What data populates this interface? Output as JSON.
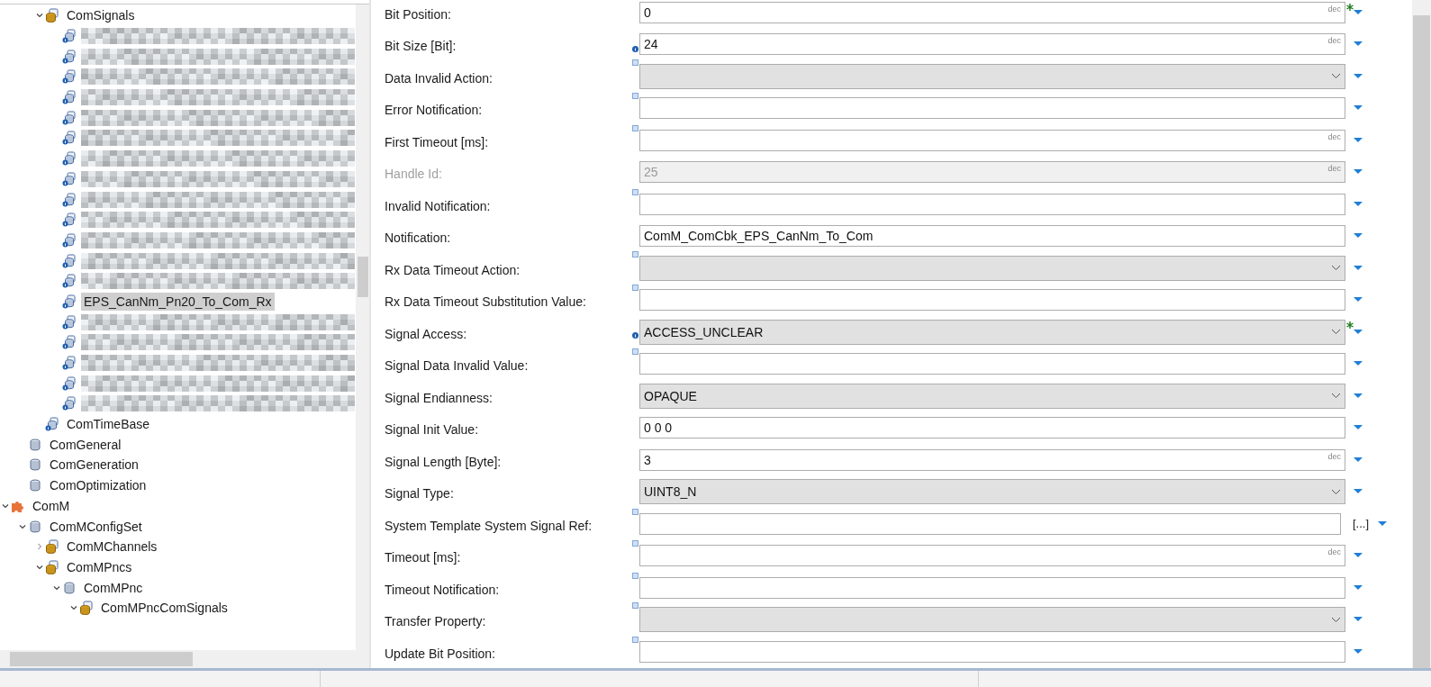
{
  "tree": {
    "items": [
      {
        "kind": "hidden",
        "children": [
          {
            "kind": "hidden",
            "children": [
              {
                "label": "ComSignals",
                "kind": "container",
                "expanded": true,
                "selected": false,
                "children": [
                  {
                    "kind": "signal",
                    "blurred": true,
                    "selected": false
                  },
                  {
                    "kind": "signal",
                    "blurred": true,
                    "selected": false
                  },
                  {
                    "kind": "signal",
                    "blurred": true,
                    "selected": false
                  },
                  {
                    "kind": "signal",
                    "blurred": true,
                    "selected": false
                  },
                  {
                    "kind": "signal",
                    "blurred": true,
                    "selected": false
                  },
                  {
                    "kind": "signal",
                    "blurred": true,
                    "selected": false
                  },
                  {
                    "kind": "signal",
                    "blurred": true,
                    "selected": false
                  },
                  {
                    "kind": "signal",
                    "blurred": true,
                    "selected": false
                  },
                  {
                    "kind": "signal",
                    "blurred": true,
                    "selected": false
                  },
                  {
                    "kind": "signal",
                    "blurred": true,
                    "selected": false
                  },
                  {
                    "kind": "signal",
                    "blurred": true,
                    "selected": false
                  },
                  {
                    "kind": "signal",
                    "blurred": true,
                    "selected": false
                  },
                  {
                    "kind": "signal",
                    "blurred": true,
                    "selected": false
                  },
                  {
                    "label": "EPS_CanNm_Pn20_To_Com_Rx",
                    "kind": "signal",
                    "blurred": false,
                    "selected": true
                  },
                  {
                    "kind": "signal",
                    "blurred": true,
                    "selected": false
                  },
                  {
                    "kind": "signal",
                    "blurred": true,
                    "selected": false
                  },
                  {
                    "kind": "signal",
                    "blurred": true,
                    "selected": false
                  },
                  {
                    "kind": "signal",
                    "blurred": true,
                    "selected": false
                  },
                  {
                    "kind": "signal",
                    "blurred": true,
                    "selected": false
                  }
                ]
              },
              {
                "label": "ComTimeBase",
                "kind": "signal",
                "selected": false
              }
            ]
          },
          {
            "label": "ComGeneral",
            "kind": "parameter",
            "selected": false
          },
          {
            "label": "ComGeneration",
            "kind": "parameter",
            "selected": false
          },
          {
            "label": "ComOptimization",
            "kind": "parameter",
            "selected": false
          }
        ]
      },
      {
        "label": "ComM",
        "kind": "module",
        "expanded": true,
        "selected": false,
        "children": [
          {
            "label": "ComMConfigSet",
            "kind": "parameter",
            "expanded": true,
            "selected": false,
            "children": [
              {
                "label": "ComMChannels",
                "kind": "container",
                "expanded": false,
                "selected": false
              },
              {
                "label": "ComMPncs",
                "kind": "container",
                "expanded": true,
                "selected": false,
                "children": [
                  {
                    "label": "ComMPnc",
                    "kind": "parameter",
                    "expanded": true,
                    "selected": false,
                    "children": [
                      {
                        "label": "ComMPncComSignals",
                        "kind": "container",
                        "expanded": true,
                        "selected": false
                      }
                    ]
                  }
                ]
              }
            ]
          }
        ]
      }
    ]
  },
  "properties": [
    {
      "label": "Bit Position:",
      "kind": "number",
      "value": "0",
      "unit": "dec",
      "info_marker": false,
      "unset_marker": false,
      "modified": true,
      "disabled": false
    },
    {
      "label": "Bit Size [Bit]:",
      "kind": "number",
      "value": "24",
      "unit": "dec",
      "info_marker": true,
      "unset_marker": false,
      "modified": false,
      "disabled": false
    },
    {
      "label": "Data Invalid Action:",
      "kind": "combo",
      "info_marker": false,
      "unset_marker": true,
      "modified": false,
      "disabled": false
    },
    {
      "label": "Error Notification:",
      "kind": "text",
      "info_marker": false,
      "unset_marker": true,
      "modified": false,
      "disabled": false
    },
    {
      "label": "First Timeout [ms]:",
      "kind": "number",
      "unit": "dec",
      "info_marker": false,
      "unset_marker": true,
      "modified": false,
      "disabled": false
    },
    {
      "label": "Handle Id:",
      "kind": "number",
      "value": "25",
      "unit": "dec",
      "info_marker": false,
      "unset_marker": false,
      "modified": false,
      "disabled": true
    },
    {
      "label": "Invalid Notification:",
      "kind": "text",
      "info_marker": false,
      "unset_marker": true,
      "modified": false,
      "disabled": false
    },
    {
      "label": "Notification:",
      "kind": "text",
      "value": "ComM_ComCbk_EPS_CanNm_To_Com",
      "info_marker": false,
      "unset_marker": false,
      "modified": false,
      "disabled": false
    },
    {
      "label": "Rx Data Timeout Action:",
      "kind": "combo",
      "info_marker": false,
      "unset_marker": true,
      "modified": false,
      "disabled": false
    },
    {
      "label": "Rx Data Timeout Substitution Value:",
      "kind": "text",
      "info_marker": false,
      "unset_marker": true,
      "modified": false,
      "disabled": false
    },
    {
      "label": "Signal Access:",
      "kind": "combo",
      "value": "ACCESS_UNCLEAR",
      "info_marker": true,
      "unset_marker": false,
      "modified": true,
      "disabled": false
    },
    {
      "label": "Signal Data Invalid Value:",
      "kind": "text",
      "info_marker": false,
      "unset_marker": true,
      "modified": false,
      "disabled": false
    },
    {
      "label": "Signal Endianness:",
      "kind": "combo",
      "value": "OPAQUE",
      "info_marker": false,
      "unset_marker": false,
      "modified": false,
      "disabled": false
    },
    {
      "label": "Signal Init Value:",
      "kind": "text",
      "value": "0 0 0",
      "info_marker": false,
      "unset_marker": false,
      "modified": false,
      "disabled": false
    },
    {
      "label": "Signal Length [Byte]:",
      "kind": "number",
      "value": "3",
      "unit": "dec",
      "info_marker": false,
      "unset_marker": false,
      "modified": false,
      "disabled": false
    },
    {
      "label": "Signal Type:",
      "kind": "combo",
      "value": "UINT8_N",
      "info_marker": false,
      "unset_marker": false,
      "modified": false,
      "disabled": false
    },
    {
      "label": "System Template System Signal Ref:",
      "kind": "reference",
      "button": "[...]",
      "info_marker": false,
      "unset_marker": true,
      "modified": false,
      "disabled": false
    },
    {
      "label": "Timeout [ms]:",
      "kind": "number",
      "unit": "dec",
      "info_marker": false,
      "unset_marker": true,
      "modified": false,
      "disabled": false
    },
    {
      "label": "Timeout Notification:",
      "kind": "text",
      "info_marker": false,
      "unset_marker": true,
      "modified": false,
      "disabled": false
    },
    {
      "label": "Transfer Property:",
      "kind": "combo",
      "info_marker": false,
      "unset_marker": true,
      "modified": false,
      "disabled": false
    },
    {
      "label": "Update Bit Position:",
      "kind": "number",
      "info_marker": false,
      "unset_marker": true,
      "modified": false,
      "disabled": false
    }
  ]
}
